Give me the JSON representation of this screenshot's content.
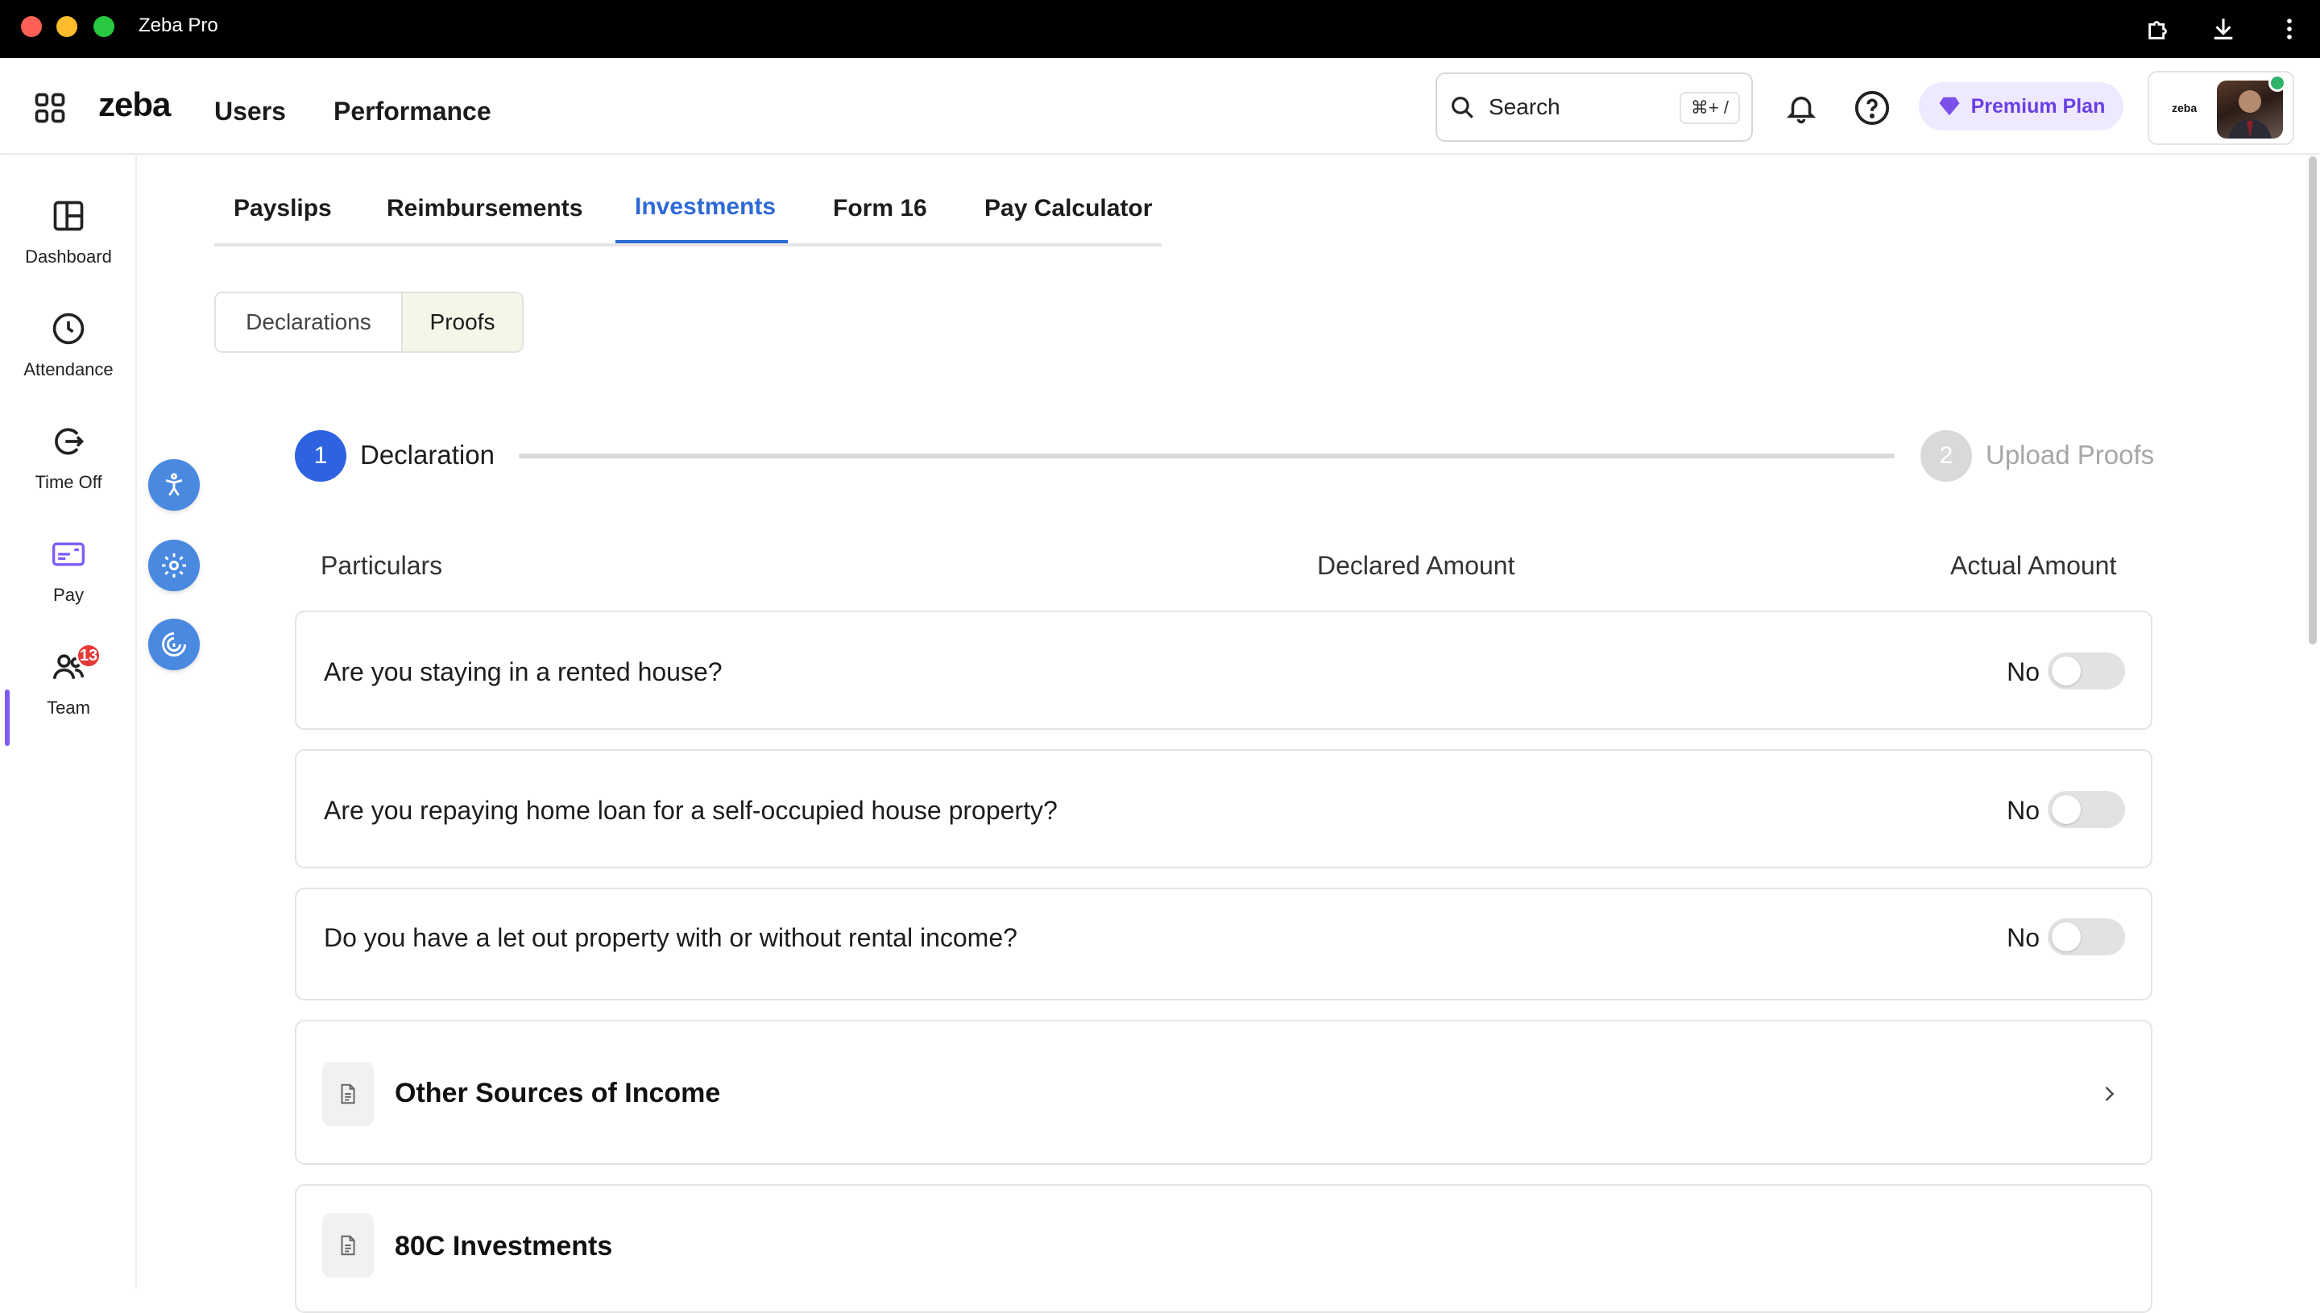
{
  "window": {
    "title": "Zeba Pro"
  },
  "header": {
    "logo": "zeba",
    "nav": [
      "Users",
      "Performance"
    ],
    "search": {
      "label": "Search",
      "shortcut": "⌘+ /"
    },
    "premium_label": "Premium Plan",
    "profile_logo": "zeba"
  },
  "sidebar": {
    "items": [
      {
        "label": "Dashboard",
        "icon": "dashboard-icon"
      },
      {
        "label": "Attendance",
        "icon": "clock-icon"
      },
      {
        "label": "Time Off",
        "icon": "logout-icon"
      },
      {
        "label": "Pay",
        "icon": "card-icon",
        "active": true
      },
      {
        "label": "Team",
        "icon": "team-icon",
        "badge": "13"
      }
    ]
  },
  "tabs": {
    "items": [
      "Payslips",
      "Reimbursements",
      "Investments",
      "Form 16",
      "Pay Calculator"
    ],
    "active": "Investments"
  },
  "segmented": {
    "items": [
      "Declarations",
      "Proofs"
    ],
    "active": "Proofs"
  },
  "stepper": {
    "steps": [
      {
        "number": "1",
        "label": "Declaration",
        "state": "active"
      },
      {
        "number": "2",
        "label": "Upload Proofs",
        "state": "inactive"
      }
    ]
  },
  "table": {
    "columns": [
      "Particulars",
      "Declared Amount",
      "Actual Amount"
    ],
    "questions": [
      {
        "text": "Are you staying in a rented house?",
        "answer": "No",
        "toggle_on": false
      },
      {
        "text": "Are you repaying home loan for a self-occupied house property?",
        "answer": "No",
        "toggle_on": false
      },
      {
        "text": "Do you have a let out property with or without rental income?",
        "answer": "No",
        "toggle_on": false
      }
    ],
    "sections": [
      "Other Sources of Income",
      "80C Investments"
    ]
  },
  "colors": {
    "accent": "#2e6ad6",
    "step_active": "#2e62e0",
    "premium_text": "#6b3fe4",
    "badge": "#e53935"
  }
}
